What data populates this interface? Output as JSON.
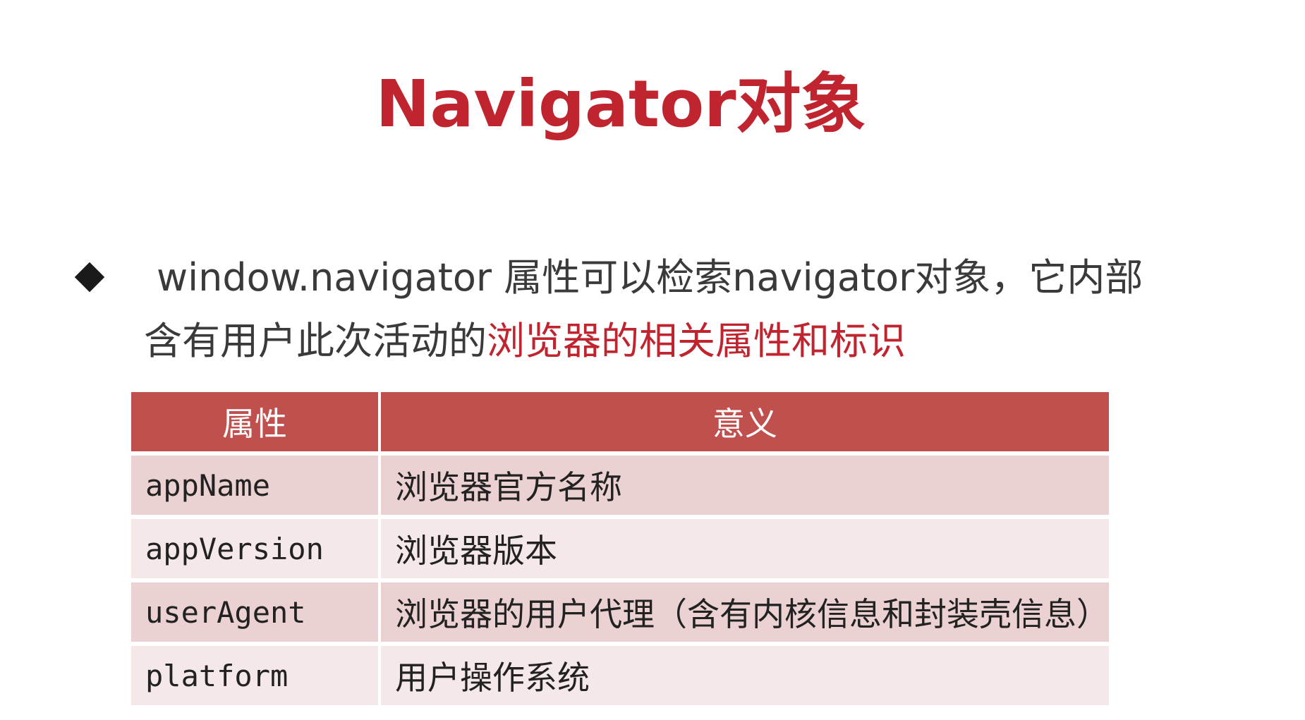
{
  "slide": {
    "title": "Navigator对象",
    "bullet": {
      "line1": "window.navigator 属性可以检索navigator对象，它内部",
      "line2_plain": "含有用户此次活动的",
      "line2_highlight": "浏览器的相关属性和标识"
    },
    "table": {
      "headers": [
        "属性",
        "意义"
      ],
      "rows": [
        {
          "property": "appName",
          "meaning": "浏览器官方名称"
        },
        {
          "property": "appVersion",
          "meaning": "浏览器版本"
        },
        {
          "property": "userAgent",
          "meaning": "浏览器的用户代理（含有内核信息和封装壳信息）"
        },
        {
          "property": "platform",
          "meaning": "用户操作系统"
        }
      ]
    },
    "colors": {
      "accent": "#c0242f",
      "header_bg": "#c0504d",
      "row_odd": "#ebd1d1",
      "row_even": "#f5e8e8"
    },
    "icons": {
      "bullet": "diamond-bullet-icon"
    }
  }
}
